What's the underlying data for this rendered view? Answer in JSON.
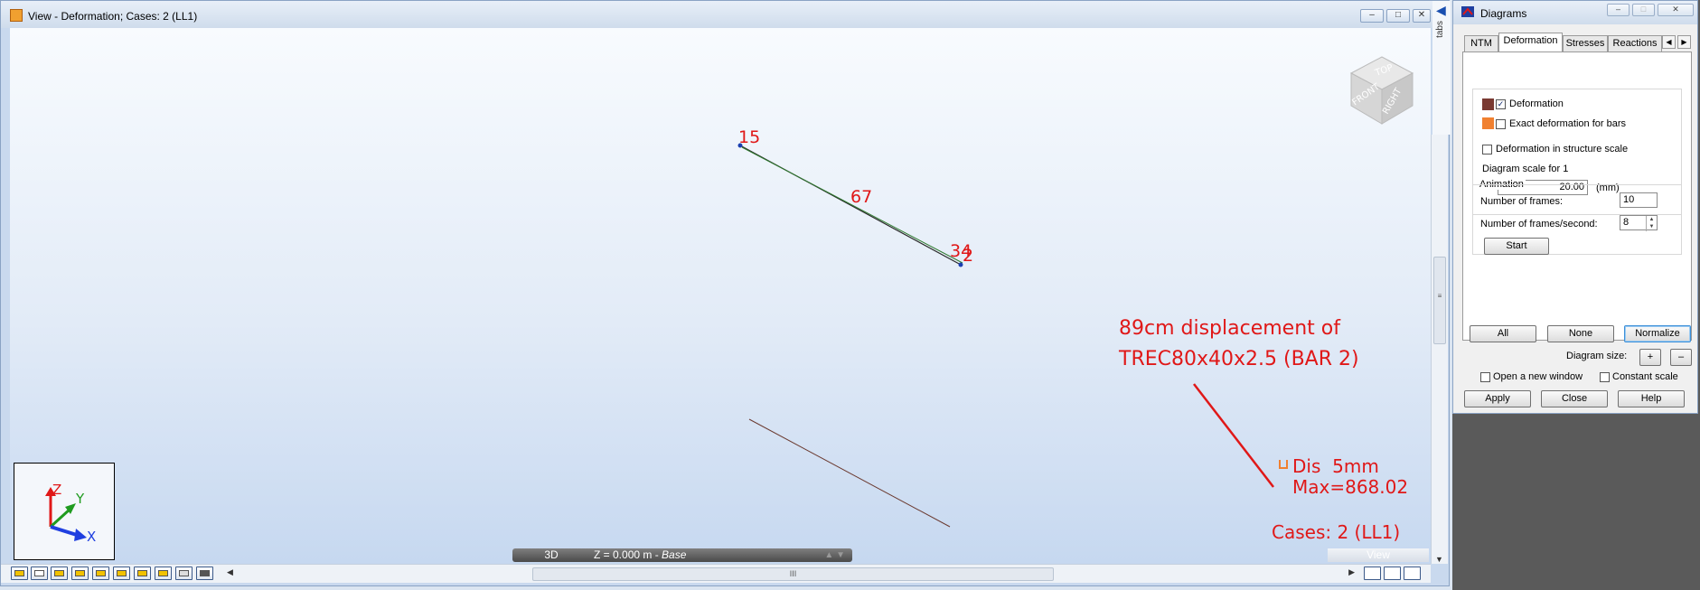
{
  "view_window": {
    "title": "View - Deformation; Cases: 2 (LL1)",
    "tabs_label": "tabs",
    "window_buttons": [
      "–",
      "□",
      "✕"
    ]
  },
  "viewport": {
    "node_labels": {
      "top_left": "15",
      "middle": "67",
      "right_a": "34",
      "right_b": "2"
    },
    "annotation": {
      "line1": "89cm displacement of",
      "line2": "TREC80x40x2.5 (BAR 2)"
    },
    "legend": {
      "dis": "Dis",
      "unit": "5mm",
      "max": "Max=868.02"
    },
    "cases": "Cases: 2 (LL1)",
    "view_cube": {
      "top": "TOP",
      "front": "FRONT",
      "right": "RIGHT"
    },
    "axes": {
      "z": "Z",
      "y": "Y",
      "x": "X"
    },
    "colors": {
      "annotation": "#e01818",
      "axis_z": "#e01818",
      "axis_y": "#1f9b1f",
      "axis_x": "#1f3fe0"
    }
  },
  "status_bar": {
    "mode": "3D",
    "plane_prefix": "Z = 0.000 m - ",
    "plane_name": "Base",
    "view": "View",
    "scroll_grip": "III"
  },
  "toolbar": {
    "icons": [
      "select-icon",
      "node-icon",
      "bar-icon",
      "support-icon",
      "load-icon",
      "section-icon",
      "panel-icon",
      "release-icon",
      "offset-icon",
      "table-icon"
    ]
  },
  "diagrams": {
    "title": "Diagrams",
    "tabs": [
      "NTM",
      "Deformation",
      "Stresses",
      "Reactions"
    ],
    "active_tab": "Deformation",
    "deformation": {
      "label": "Deformation",
      "checked": true,
      "color": "#7a3a32"
    },
    "exact_deformation": {
      "label": "Exact deformation for bars",
      "checked": false,
      "color": "#f08030"
    },
    "structure_scale": {
      "label": "Deformation in structure scale",
      "checked": false
    },
    "diagram_scale_label": "Diagram scale for 1",
    "diagram_scale_value": "20.00",
    "diagram_scale_unit": "(mm)",
    "animation": {
      "title": "Animation",
      "frames_label": "Number of frames:",
      "frames_value": "10",
      "fps_label": "Number of frames/second:",
      "fps_value": "8",
      "start": "Start"
    },
    "buttons": {
      "all": "All",
      "none": "None",
      "normalize": "Normalize"
    },
    "diagram_size_label": "Diagram size:",
    "diagram_size_plus": "+",
    "diagram_size_minus": "–",
    "open_new_window": {
      "label": "Open a new window",
      "checked": false
    },
    "constant_scale": {
      "label": "Constant scale",
      "checked": false
    },
    "footer": {
      "apply": "Apply",
      "close": "Close",
      "help": "Help"
    }
  }
}
